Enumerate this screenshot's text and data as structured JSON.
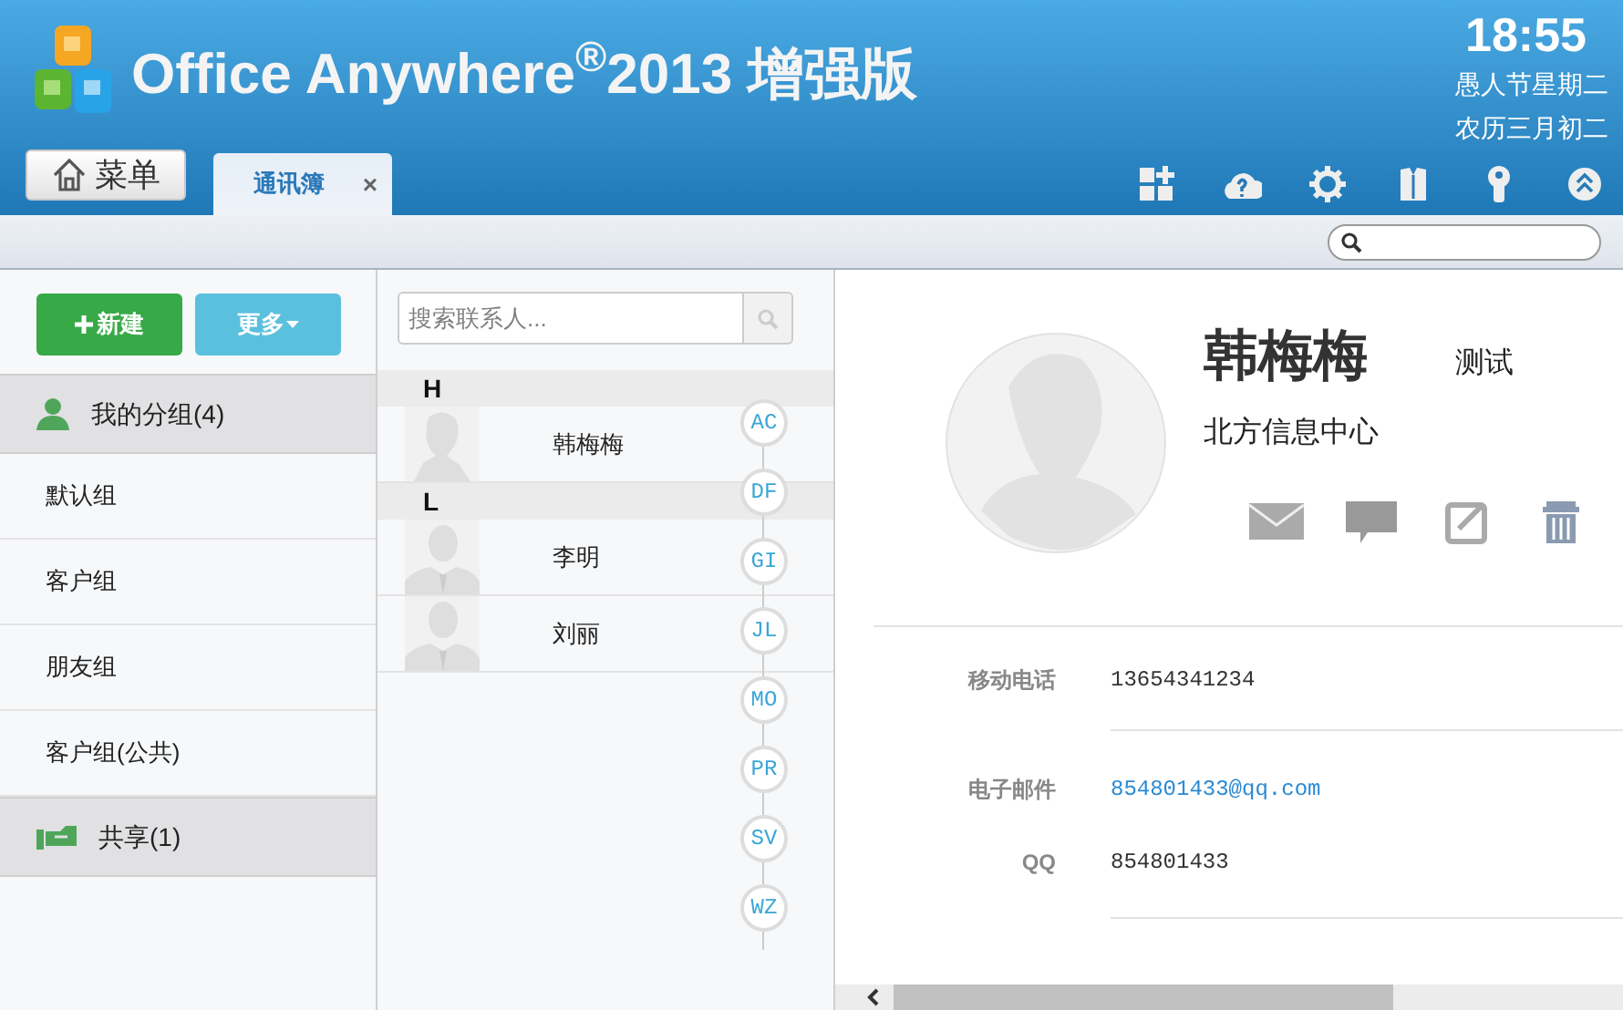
{
  "header": {
    "title": "Office Anywhere$^{®}$2013 增强版",
    "time": "18:55",
    "holiday": "愚人节星期二",
    "lunar": "农历三月初二"
  },
  "menu_button": "菜单",
  "tabs": [
    {
      "label": "通讯簿",
      "selected": true,
      "close": "×"
    }
  ],
  "left_panel": {
    "buttons": [
      {
        "label": "新建",
        "kind": "new"
      },
      {
        "label": "更多",
        "kind": "more"
      }
    ],
    "sections": [
      {
        "title": "我的分组(4)",
        "kind": "groups",
        "items": [
          "默认组",
          "客户组",
          "朋友组",
          "客户组(公共)"
        ]
      },
      {
        "title": "共享(1)",
        "kind": "shared"
      }
    ]
  },
  "search": {
    "placeholder": "搜索联系人..."
  },
  "contact_sections": [
    {
      "letter": "H",
      "contacts": [
        {
          "name": "韩梅梅",
          "kind": "female"
        }
      ]
    },
    {
      "letter": "L",
      "contacts": [
        {
          "name": "李明",
          "kind": "male"
        },
        {
          "name": "刘丽",
          "kind": "male"
        }
      ]
    }
  ],
  "alphabet_index": [
    "AC",
    "DF",
    "GI",
    "JL",
    "MO",
    "PR",
    "SV",
    "WZ"
  ],
  "detail": {
    "name": "韩梅梅",
    "tag": "测试",
    "department": "北方信息中心",
    "fields": [
      {
        "label": "移动电话",
        "value": "13654341234",
        "kind": "text"
      },
      {
        "label": "电子邮件",
        "value": "854801433@qq.com",
        "kind": "link"
      },
      {
        "label": "QQ",
        "value": "854801433",
        "kind": "text"
      }
    ]
  }
}
